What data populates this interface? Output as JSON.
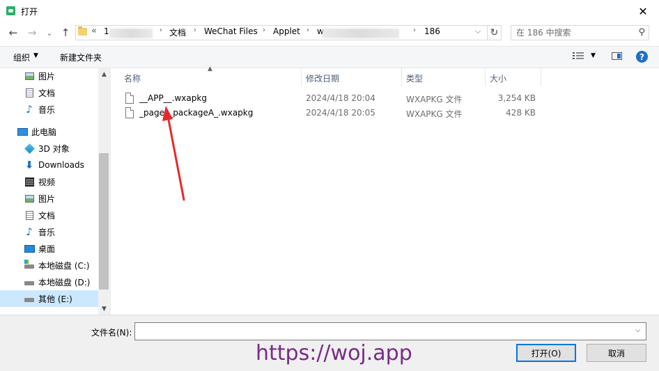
{
  "window": {
    "title": "打开",
    "close": "✕"
  },
  "nav": {
    "back": "←",
    "forward": "→",
    "recent": "⌄",
    "up": "↑",
    "overflow": "«",
    "path": [
      "1",
      "",
      "文档",
      "WeChat Files",
      "Applet",
      "w",
      "",
      "186"
    ],
    "separator": "›",
    "dropdown": "⌵",
    "refresh": "↻",
    "search_placeholder": "在 186 中搜索",
    "search_icon": "⚲"
  },
  "toolbar": {
    "organize": "组织",
    "new_folder": "新建文件夹",
    "caret": "▼",
    "help": "?"
  },
  "sidebar": {
    "items": [
      {
        "label": "图片",
        "icon": "pictures-icon"
      },
      {
        "label": "文档",
        "icon": "documents-icon"
      },
      {
        "label": "音乐",
        "icon": "music-icon"
      },
      {
        "label": "此电脑",
        "icon": "this-pc-icon"
      },
      {
        "label": "3D 对象",
        "icon": "3d-objects-icon"
      },
      {
        "label": "Downloads",
        "icon": "downloads-icon"
      },
      {
        "label": "视频",
        "icon": "videos-icon"
      },
      {
        "label": "图片",
        "icon": "pictures-icon"
      },
      {
        "label": "文档",
        "icon": "documents-icon"
      },
      {
        "label": "音乐",
        "icon": "music-icon"
      },
      {
        "label": "桌面",
        "icon": "desktop-icon"
      },
      {
        "label": "本地磁盘 (C:)",
        "icon": "drive-c-icon"
      },
      {
        "label": "本地磁盘 (D:)",
        "icon": "drive-icon"
      },
      {
        "label": "其他 (E:)",
        "icon": "drive-icon",
        "selected": true
      }
    ],
    "scroll_up": "▲",
    "scroll_down": "▼"
  },
  "columns": {
    "name": "名称",
    "modified": "修改日期",
    "type": "类型",
    "size": "大小",
    "sort_indicator": "▲"
  },
  "files": [
    {
      "name": "__APP__.wxapkg",
      "modified": "2024/4/18 20:04",
      "type": "WXAPKG 文件",
      "size": "3,254 KB"
    },
    {
      "name": "_pages_packageA_.wxapkg",
      "modified": "2024/4/18 20:05",
      "type": "WXAPKG 文件",
      "size": "428 KB"
    }
  ],
  "bottom": {
    "filename_label": "文件名(N):",
    "filename_value": "",
    "open": "打开(O)",
    "cancel": "取消",
    "watermark": "https://woj.app"
  },
  "colors": {
    "accent": "#0078d7",
    "selected_bg": "#cce8ff",
    "arrow": "#e8282b",
    "watermark": "#7a2a88"
  }
}
